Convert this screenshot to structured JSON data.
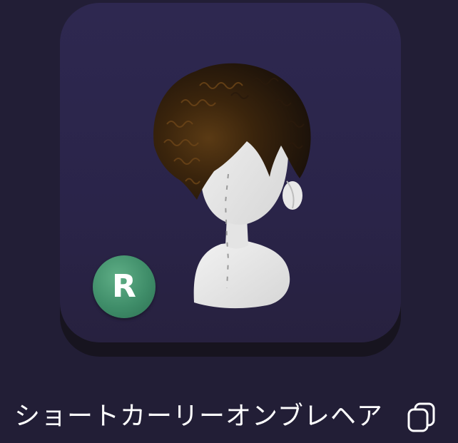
{
  "item": {
    "name": "ショートカーリーオンブレヘア",
    "rarity": "R",
    "preview_icon": "curly-hair-avatar-icon",
    "copy_icon": "copy-icon"
  },
  "colors": {
    "background": "#221e36",
    "card": "#2b2549",
    "rarity_badge": "#3f8d69",
    "text": "#ffffff"
  }
}
